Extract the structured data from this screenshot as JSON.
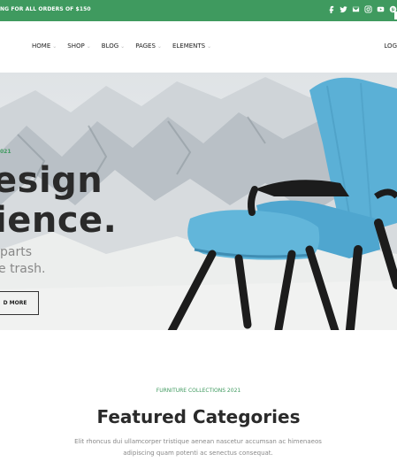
{
  "topbar": {
    "promo_text": "NG FOR ALL ORDERS OF $150",
    "socials": [
      "facebook-icon",
      "twitter-icon",
      "mail-icon",
      "instagram-icon",
      "youtube-icon",
      "pinterest-icon"
    ],
    "bg_color": "#3f9a5f"
  },
  "nav": {
    "items": [
      {
        "label": "HOME",
        "has_dropdown": true
      },
      {
        "label": "SHOP",
        "has_dropdown": true
      },
      {
        "label": "BLOG",
        "has_dropdown": true
      },
      {
        "label": "PAGES",
        "has_dropdown": true
      },
      {
        "label": "ELEMENTS",
        "has_dropdown": true
      }
    ],
    "login_label": "LOG"
  },
  "hero": {
    "year_label": "021",
    "headline_line1": "esign",
    "headline_line2": "ience.",
    "sub_line1": "parts",
    "sub_line2": "e trash.",
    "button_label": "D MORE",
    "accent_color": "#3f9a5f",
    "chair_color": "#5bb0d6"
  },
  "featured": {
    "subtitle": "FURNITURE COLLECTIONS 2021",
    "title": "Featured Categories",
    "description": "Elit rhoncus dui ullamcorper tristique aenean nascetur accumsan ac himenaeos adipiscing quam potenti ac senectus consequat."
  }
}
